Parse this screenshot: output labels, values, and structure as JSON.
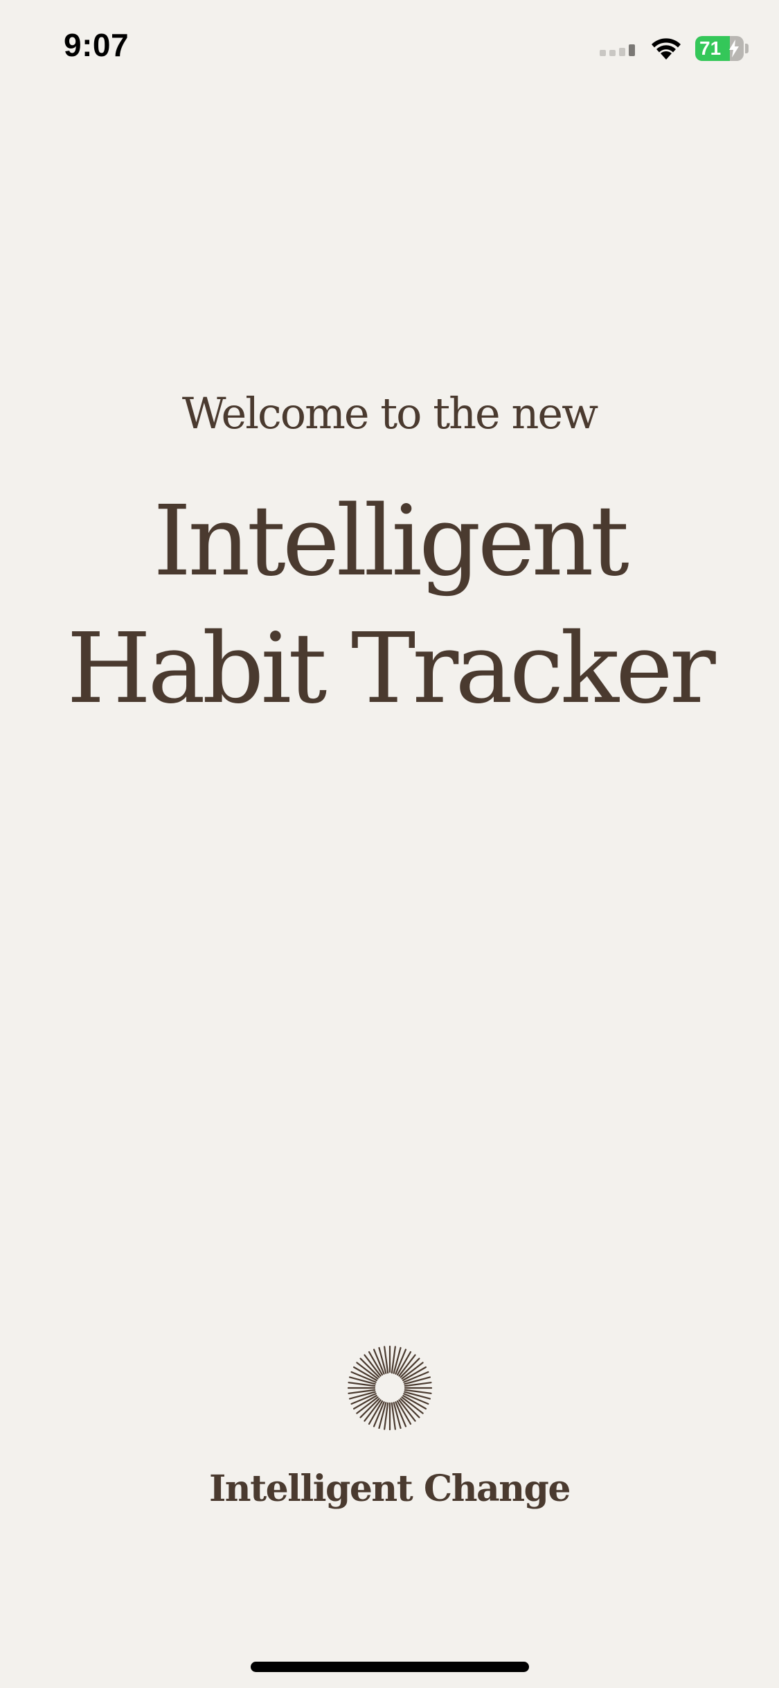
{
  "status_bar": {
    "time": "9:07",
    "battery_level": "71",
    "battery_fraction": 0.71,
    "battery_charging": true,
    "icons": [
      "signal-icon",
      "wifi-icon",
      "battery-icon",
      "charging-bolt-icon"
    ]
  },
  "splash": {
    "welcome": "Welcome to the new",
    "title_line_1": "Intelligent",
    "title_line_2": "Habit Tracker"
  },
  "brand": {
    "name": "Intelligent Change",
    "logo_icon": "sunburst-triangle-logo-icon"
  },
  "colors": {
    "background": "#f3f1ed",
    "text": "#4a3a2f",
    "battery_green": "#34c759"
  }
}
